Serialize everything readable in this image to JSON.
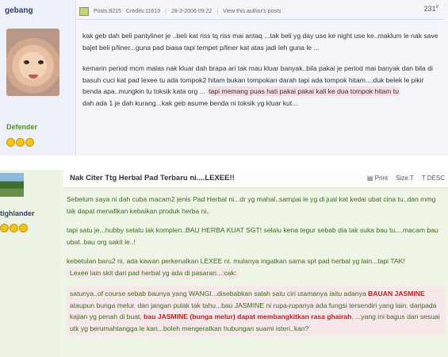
{
  "post1": {
    "username": "gebang",
    "rank": "Defender",
    "meta": {
      "posts": "Posts:8215",
      "credits": "Credits:11619",
      "date": "28-3-2006 09:22",
      "profile_link": "View this author's posts"
    },
    "post_number": "231",
    "paragraphs": [
      "kak geb dah beli pantyliner je ..beli kat riss tq riss mai antaq ...tak beli yg day use ke night use ke..maklum le nak save bajet beli p/liner...guna pad biasa tapi tempet p/liner kat atas jadi leh guna le ...",
      "kemarin period mcm malas nak kluar dah brapa ari tak mau kluar banyak..bila pakai je period mai banyak dan bila di basuh cuci kat pad lexee tu ada tompok2 hitam bukan tompokan darah tapi ada tompok hitam....duk belek le pikir benda apa..mungkin tu toksik kata org ...",
      "tapi memang puas hati pakai pakai kali ke dua tompok hitam tu",
      "dah ada 1 je dah kurang...kak geb asume benda ni toksik yg kluar kut..."
    ]
  },
  "post2": {
    "username": "tighlander",
    "title": "Nak Citer Ttg Herbal Pad Terbaru ni....LEXEE!!",
    "tools": {
      "print": "Print",
      "size": "Size:T",
      "desc": "T DESC"
    },
    "p1": "Sebelum saya ni dah cuba macam2 jenis Pad Herbal ni...dr yg mahal..sampai le yg di jual kat kedai ubat cina tu..dan mmg tak dapat menafikan kebaikan produk herba ni..",
    "p2": "tapi satu je...hubby selalu lak komplen..BAU HERBA KUAT SGT! selalu kena tegur sebab dia tak suka bau tu....macam bau ubat..bau org sakit le..!",
    "p3a": "kebetulan baru2 ni, ada kawan perkenalkan LEXEE ni. mulanya ingatkan sama spt pad herbal yg lain...tapi TAK!",
    "p3b": "Lexee lain skit dari pad herbal yg ada di pasaran...:cak:",
    "p4_a": "satunya..of course sebab baunya yang WANGI...disebabkan salah satu ciri utamanya iaitu adanya ",
    "p4_red1": "BAUAN JASMINE",
    "p4_b": " ataupun bunga melur. dan jangan pulak tak tahu...bau JASMINE ni rupa-rupanya ada fungsi tersendiri yang lain. daripada kajian yg penah di buat, ",
    "p4_red2": "bau JASMINE (bunga melur) dapat membangkitkan rasa ghairah",
    "p4_c": ". ...yang ini bagus dan sesuai utk yg berumahtangga le kan...boleh mengeratkan hubungan suami isteri..kan?"
  }
}
